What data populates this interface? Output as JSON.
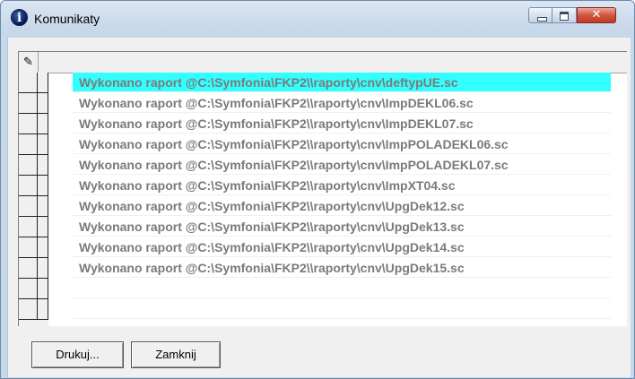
{
  "window": {
    "title": "Komunikaty",
    "title_icon": "info-icon",
    "controls": {
      "minimize": "minimize-icon",
      "maximize": "maximize-icon",
      "close": "close-icon"
    }
  },
  "grid": {
    "header_icon": "pencil-icon",
    "rows": [
      "Wykonano raport @C:\\Symfonia\\FKP2\\\\raporty\\cnv\\deftypUE.sc",
      "Wykonano raport @C:\\Symfonia\\FKP2\\\\raporty\\cnv\\ImpDEKL06.sc",
      "Wykonano raport @C:\\Symfonia\\FKP2\\\\raporty\\cnv\\ImpDEKL07.sc",
      "Wykonano raport @C:\\Symfonia\\FKP2\\\\raporty\\cnv\\ImpPOLADEKL06.sc",
      "Wykonano raport @C:\\Symfonia\\FKP2\\\\raporty\\cnv\\ImpPOLADEKL07.sc",
      "Wykonano raport @C:\\Symfonia\\FKP2\\\\raporty\\cnv\\ImpXT04.sc",
      "Wykonano raport @C:\\Symfonia\\FKP2\\\\raporty\\cnv\\UpgDek12.sc",
      "Wykonano raport @C:\\Symfonia\\FKP2\\\\raporty\\cnv\\UpgDek13.sc",
      "Wykonano raport @C:\\Symfonia\\FKP2\\\\raporty\\cnv\\UpgDek14.sc",
      "Wykonano raport @C:\\Symfonia\\FKP2\\\\raporty\\cnv\\UpgDek15.sc",
      "",
      ""
    ],
    "selected_row": 0,
    "selected_color": "#33ffff",
    "text_color": "#7a7a7a"
  },
  "buttons": {
    "print_label": "Drukuj...",
    "close_label": "Zamknij"
  }
}
